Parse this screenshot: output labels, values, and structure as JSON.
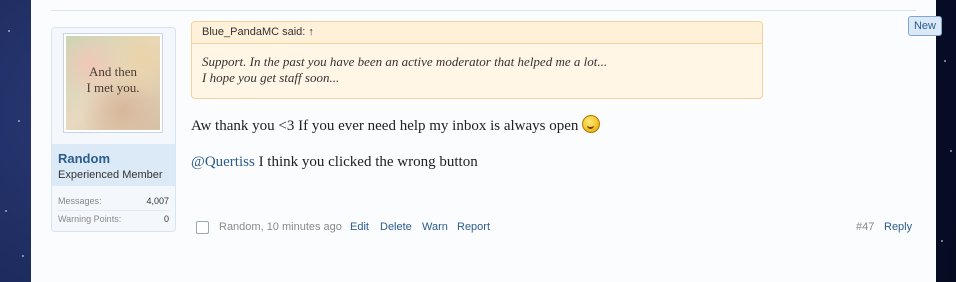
{
  "badge": {
    "new_label": "New"
  },
  "user": {
    "avatar_text_line1": "And then",
    "avatar_text_line2": "I met you.",
    "name": "Random",
    "title": "Experienced Member",
    "messages_label": "Messages:",
    "messages_value": "4,007",
    "warning_label": "Warning Points:",
    "warning_value": "0"
  },
  "quote": {
    "author": "Blue_PandaMC said: ↑",
    "line1": "Support. In the past you have been an active moderator that helped me a lot...",
    "line2": "I hope you get staff soon..."
  },
  "message": {
    "line1": "Aw thank you <3 If you ever need help my inbox is always open",
    "mention": "@Quertiss",
    "line2_rest": " I think you clicked the wrong button"
  },
  "footer": {
    "meta": "Random, 10 minutes ago",
    "edit": "Edit",
    "delete": "Delete",
    "warn": "Warn",
    "report": "Report",
    "post_number": "#47",
    "reply": "Reply"
  }
}
